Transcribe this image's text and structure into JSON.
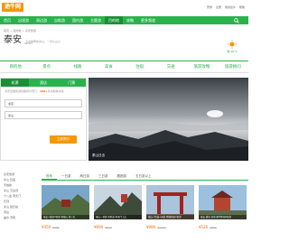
{
  "logo": {
    "text": "途牛网"
  },
  "toplinks": [
    "登录",
    "注册",
    "我的途牛",
    "帮助"
  ],
  "nav": {
    "items": [
      {
        "label": "首页"
      },
      {
        "label": "出境游"
      },
      {
        "label": "周边游"
      },
      {
        "label": "自助游"
      },
      {
        "label": "国内游"
      },
      {
        "label": "主题游"
      },
      {
        "label": "目的地"
      },
      {
        "label": "攻略"
      },
      {
        "label": "更多频道"
      }
    ],
    "active_index": 6
  },
  "breadcrumb": "首页 > 目的地 > 泰安旅游",
  "city": {
    "name": "泰安",
    "pinyin": "Tai'an",
    "slogan": "五岳独尊的泰山，一览众山小"
  },
  "weather": {
    "label": "晴 26°C"
  },
  "subnav": [
    "目的地",
    "景点",
    "线路",
    "美食",
    "住宿",
    "交通",
    "旅游攻略",
    "旅游顾问"
  ],
  "booking": {
    "tabs": [
      "机票",
      "酒店",
      "门票"
    ],
    "promo_prefix": "泰安经典旅游线路特价预订，",
    "promo_highlight": "100+",
    "promo_suffix": "条线路等你来",
    "from_placeholder": "北京",
    "to_placeholder": "泰山",
    "submit": "立即预订"
  },
  "photo_caption": "泰山日出",
  "sidebar": {
    "rows": [
      "泰安旅游",
      "泰山 岱庙",
      "天烛峰",
      "泰山 玉皇顶",
      "十八盘 南天门",
      "石刻",
      "泰山 经石峪",
      "周边",
      "曲阜 济南"
    ]
  },
  "categories": [
    "推荐",
    "一日游",
    "两日游",
    "三日游",
    "跟团游",
    "五日游以上"
  ],
  "cards": [
    {
      "title": "泰安+曲阜2日游 登泰山 游三孔",
      "price": "¥450",
      "orig": "¥580"
    },
    {
      "title": "泰山一日游 含索道 中天门上山",
      "price": "¥690",
      "orig": "¥820"
    },
    {
      "title": "泰山+岱庙+天街 经典纯玩3日游",
      "price": "¥980",
      "orig": "¥1200"
    },
    {
      "title": "泰安 曲阜 济南 豪华休闲4日游",
      "price": "¥520",
      "orig": "¥650"
    }
  ]
}
